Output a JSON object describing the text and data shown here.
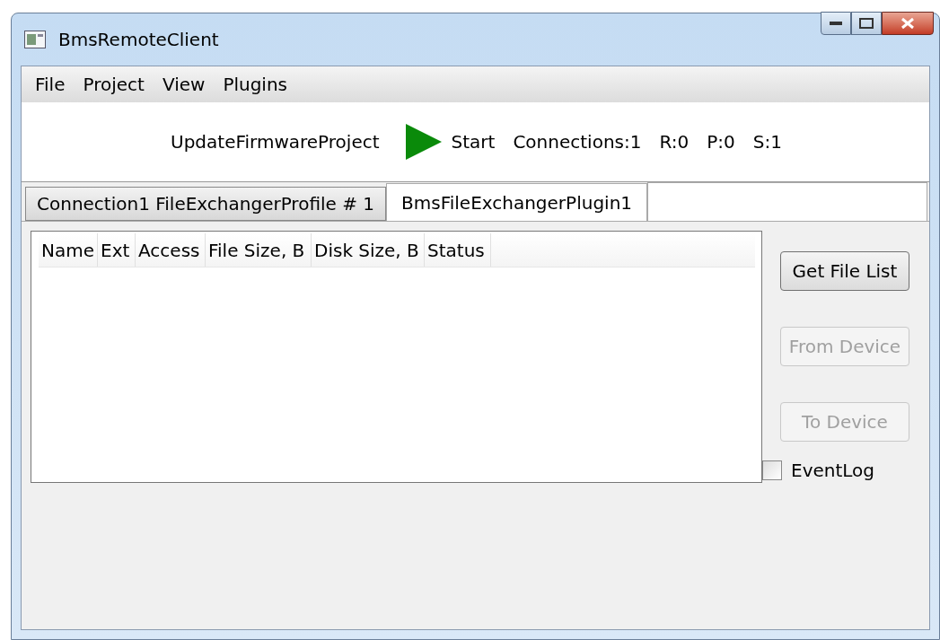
{
  "window": {
    "title": "BmsRemoteClient"
  },
  "menu": [
    "File",
    "Project",
    "View",
    "Plugins"
  ],
  "toolbar": {
    "project": "UpdateFirmwareProject",
    "start": "Start",
    "connections": "Connections:1",
    "r": "R:0",
    "p": "P:0",
    "s": "S:1"
  },
  "tabs": [
    {
      "label": "Connection1 FileExchangerProfile # 1",
      "selected": false
    },
    {
      "label": "BmsFileExchangerPlugin1",
      "selected": true
    }
  ],
  "table": {
    "columns": [
      "Name",
      "Ext",
      "Access",
      "File Size, B",
      "Disk Size, B",
      "Status"
    ]
  },
  "buttons": [
    {
      "label": "Get File List",
      "disabled": false
    },
    {
      "label": "From Device",
      "disabled": true
    },
    {
      "label": "To Device",
      "disabled": true
    }
  ],
  "event_log": {
    "label": "EventLog",
    "checked": false
  }
}
